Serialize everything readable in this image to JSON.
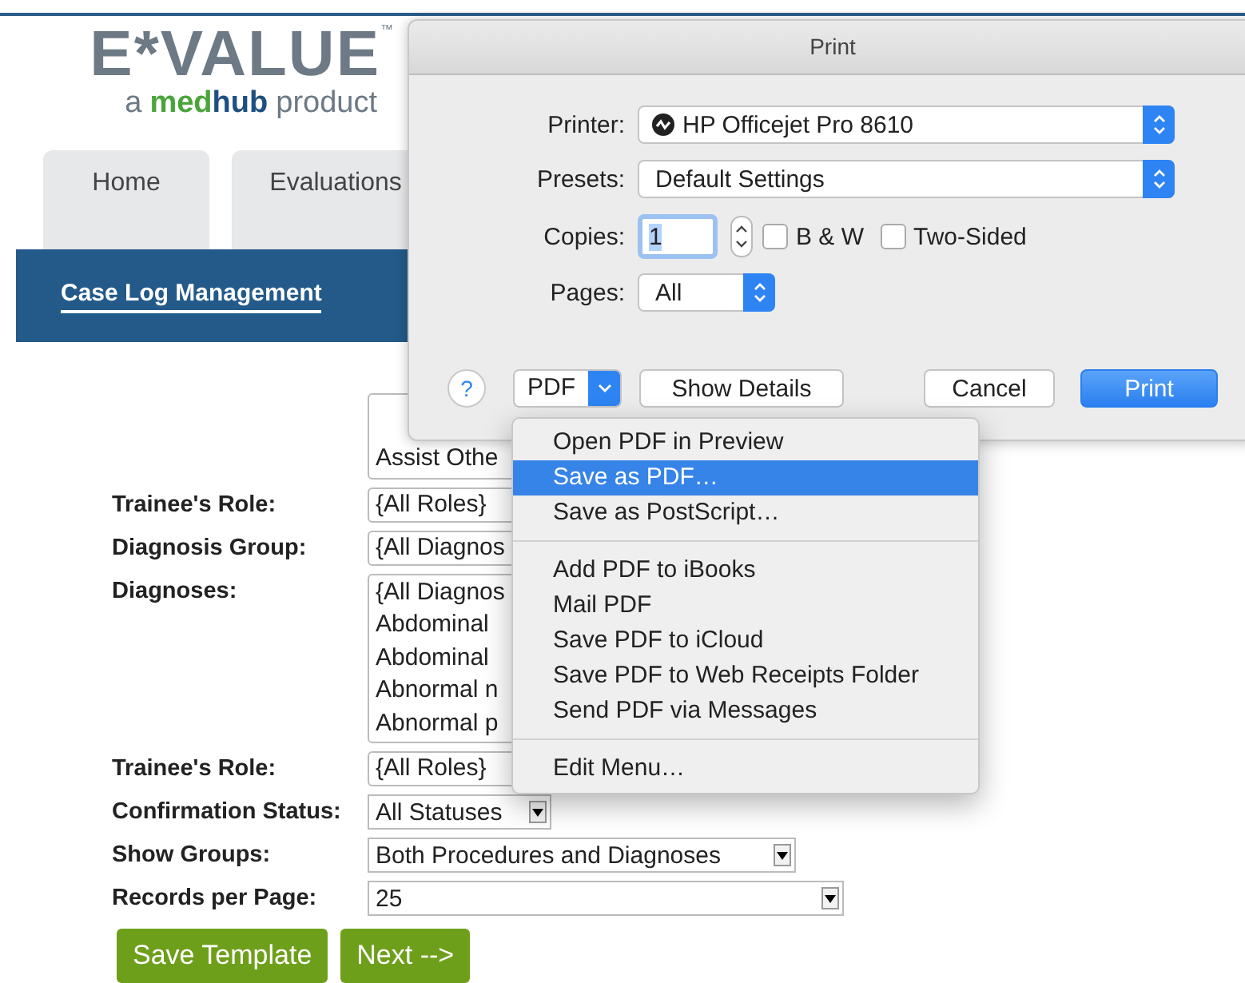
{
  "logo": {
    "name": "E*VALUE",
    "trademark": "™",
    "tagline_prefix": "a",
    "brand_first": "med",
    "brand_second": "hub",
    "tagline_suffix": "product"
  },
  "tabs": [
    {
      "label": "Home",
      "selected": false
    },
    {
      "label": "Evaluations",
      "selected": false
    }
  ],
  "subnav": {
    "label": "Case Log Management"
  },
  "form": {
    "rows": [
      {
        "label": "",
        "kind": "list",
        "lines": [
          "Assist Othe"
        ]
      },
      {
        "label": "Trainee's Role:",
        "kind": "select",
        "value": "{All Roles}"
      },
      {
        "label": "Diagnosis Group:",
        "kind": "select",
        "value": "{All Diagnos"
      },
      {
        "label": "Diagnoses:",
        "kind": "list",
        "lines": [
          "{All Diagnos",
          "Abdominal",
          "Abdominal",
          "Abnormal n",
          "Abnormal p"
        ]
      },
      {
        "label": "Trainee's Role:",
        "kind": "select",
        "value": "{All Roles}"
      },
      {
        "label": "Confirmation Status:",
        "kind": "dropdown",
        "value": "All Statuses"
      },
      {
        "label": "Show Groups:",
        "kind": "dropdown",
        "value": "Both Procedures and Diagnoses"
      },
      {
        "label": "Records per Page:",
        "kind": "dropdown",
        "value": "25"
      }
    ],
    "buttons": [
      "Save Template",
      "Next -->"
    ]
  },
  "dialog": {
    "title": "Print",
    "printer": {
      "label": "Printer:",
      "value": "HP Officejet Pro 8610"
    },
    "presets": {
      "label": "Presets:",
      "value": "Default Settings"
    },
    "copies": {
      "label": "Copies:",
      "value": "1"
    },
    "checkboxes": [
      {
        "label": "B & W",
        "checked": false
      },
      {
        "label": "Two-Sided",
        "checked": false
      }
    ],
    "pages": {
      "label": "Pages:",
      "value": "All"
    },
    "help": "?",
    "pdf_button": "PDF",
    "buttons": [
      {
        "label": "Show Details",
        "kind": "normal"
      },
      {
        "label": "Cancel",
        "kind": "normal"
      },
      {
        "label": "Print",
        "kind": "default"
      }
    ]
  },
  "pdf_menu": {
    "groups": [
      [
        {
          "label": "Open PDF in Preview",
          "selected": false
        },
        {
          "label": "Save as PDF…",
          "selected": true
        },
        {
          "label": "Save as PostScript…",
          "selected": false
        }
      ],
      [
        {
          "label": "Add PDF to iBooks",
          "selected": false
        },
        {
          "label": "Mail PDF",
          "selected": false
        },
        {
          "label": "Save PDF to iCloud",
          "selected": false
        },
        {
          "label": "Save PDF to Web Receipts Folder",
          "selected": false
        },
        {
          "label": "Send PDF via Messages",
          "selected": false
        }
      ],
      [
        {
          "label": "Edit Menu…",
          "selected": false
        }
      ]
    ]
  }
}
